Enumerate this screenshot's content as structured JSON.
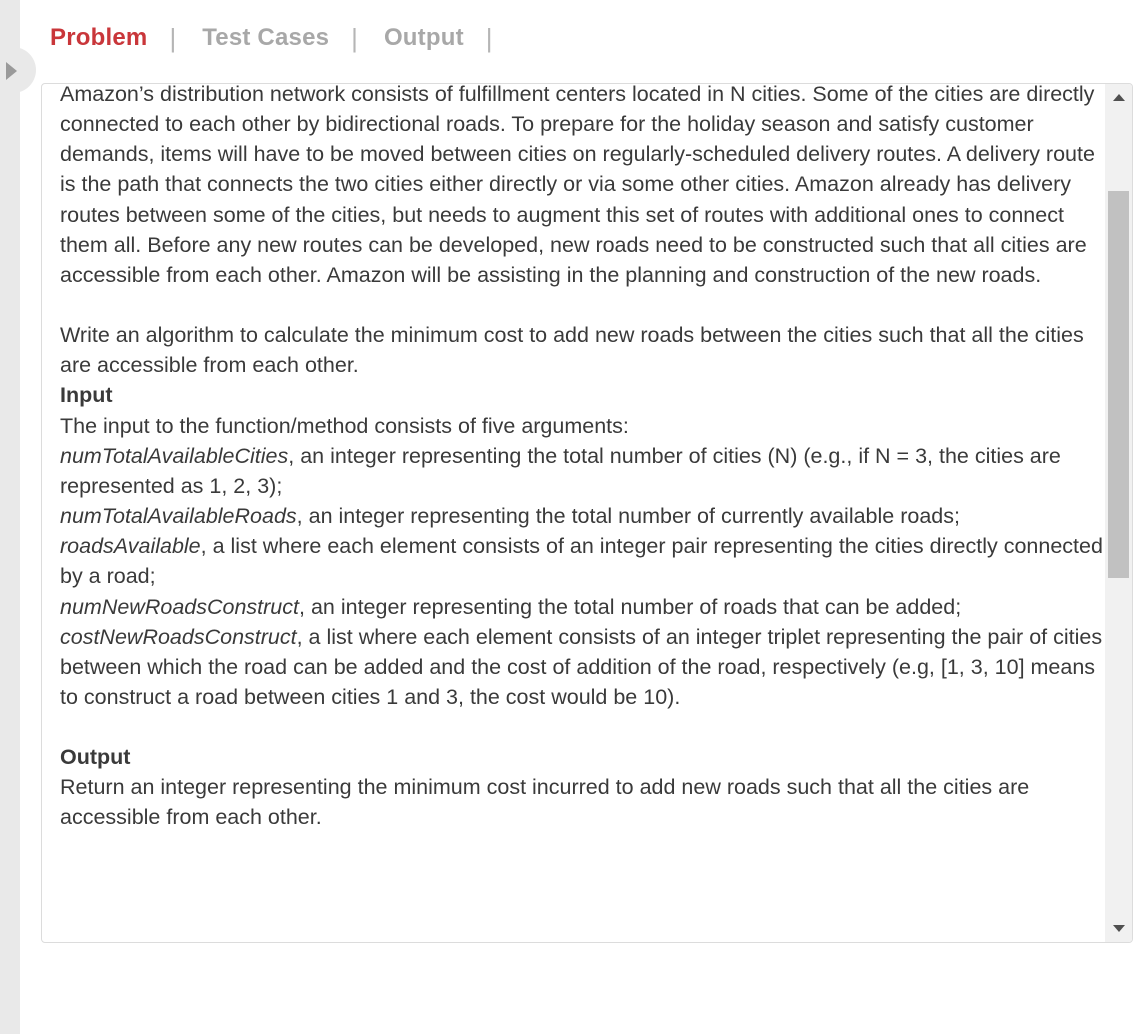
{
  "tabs": [
    {
      "label": "Problem",
      "active": true
    },
    {
      "label": "Test Cases",
      "active": false
    },
    {
      "label": "Output",
      "active": false
    }
  ],
  "tab_separator": "|",
  "colors": {
    "active_tab": "#c9363a",
    "inactive_tab": "#a8a8a8",
    "text": "#3a3a3a"
  },
  "problem": {
    "description": "Amazon’s distribution network consists of fulfillment centers located in N cities. Some of the cities are directly connected to each other by bidirectional roads. To prepare for the holiday season and satisfy customer demands, items will have to be moved between cities on regularly-scheduled delivery routes. A delivery route is the path that connects the two cities either directly or via some other cities. Amazon already has delivery routes between some of the cities, but needs to augment this set of routes with additional ones to connect them all. Before any new routes can be developed, new roads need to be constructed such that all cities are accessible from each other. Amazon will be assisting in the planning and construction of the new roads.",
    "task": "Write an algorithm to calculate the minimum cost to add new roads between the cities such that all the cities are accessible from each other.",
    "input_heading": "Input",
    "input_intro": "The input to the function/method consists of five arguments:",
    "params": [
      {
        "name": "numTotalAvailableCities",
        "desc": ", an integer representing the total number of cities (N) (e.g., if N = 3, the cities are represented as 1, 2, 3);"
      },
      {
        "name": "numTotalAvailableRoads",
        "desc": ", an integer representing the total number of currently available roads;"
      },
      {
        "name": "roadsAvailable",
        "desc": ", a list where each element consists of an integer pair representing the cities directly connected by a road;"
      },
      {
        "name": "numNewRoadsConstruct",
        "desc": ", an integer representing the total number of roads that can be added;"
      },
      {
        "name": "costNewRoadsConstruct",
        "desc": ", a list where each element consists of an integer triplet representing the pair of cities between which the road can be added and the cost of addition of the road, respectively (e.g, [1, 3, 10] means to construct a road between cities 1 and 3, the cost would be 10)."
      }
    ],
    "output_heading": "Output",
    "output_text": "Return an integer representing the minimum cost incurred to add new roads such that all the cities are accessible from each other."
  }
}
